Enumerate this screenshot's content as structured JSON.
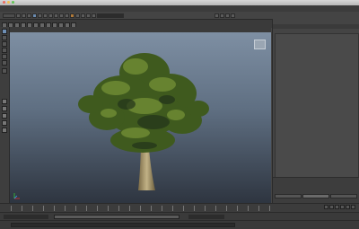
{
  "window": {
    "title": "",
    "traffic_lights": [
      "#ec6a5e",
      "#f4bf4f",
      "#61c554"
    ]
  },
  "menubar": {
    "items": []
  },
  "statusline": {
    "icons": [
      "select-icon",
      "lasso-icon",
      "paint-icon",
      "move-icon",
      "rotate-icon",
      "scale-icon",
      "snap-grid-icon",
      "snap-curve-icon",
      "snap-point-icon",
      "render-icon",
      "ipr-icon",
      "render-settings-icon"
    ]
  },
  "shelf": {
    "tabs": []
  },
  "toolbox": {
    "tools": [
      "select-tool",
      "lasso-tool",
      "paint-select-tool",
      "move-tool",
      "rotate-tool",
      "scale-tool",
      "layout-single",
      "layout-four",
      "layout-outliner",
      "layout-graph"
    ]
  },
  "viewport": {
    "menu": [],
    "background_top": "#7e8fa3",
    "background_bottom": "#2e3540",
    "subject": "tree-model"
  },
  "channel_box": {
    "header": "",
    "tabs": [],
    "layer_tabs": []
  },
  "time_slider": {
    "current_frame": ""
  },
  "command_line": {
    "label": "",
    "value": ""
  }
}
